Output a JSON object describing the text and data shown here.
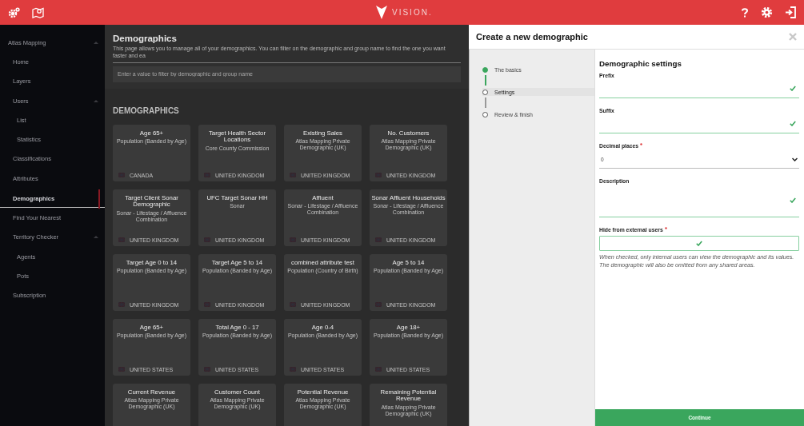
{
  "header": {
    "brand": "VISION."
  },
  "sidebar": {
    "items": [
      {
        "label": "Atlas Mapping",
        "expanded": true,
        "selected": false,
        "children": [
          {
            "label": "Home",
            "selected": false
          },
          {
            "label": "Layers",
            "selected": false
          },
          {
            "label": "Users",
            "expanded": true,
            "selected": false,
            "children": [
              {
                "label": "List",
                "selected": false
              },
              {
                "label": "Statistics",
                "selected": false
              }
            ]
          },
          {
            "label": "Classifications",
            "selected": false
          },
          {
            "label": "Attributes",
            "selected": false
          },
          {
            "label": "Demographics",
            "selected": true
          },
          {
            "label": "Find Your Nearest",
            "selected": false
          },
          {
            "label": "Territory Checker",
            "expanded": true,
            "selected": false,
            "children": [
              {
                "label": "Agents",
                "selected": false
              },
              {
                "label": "Pots",
                "selected": false
              }
            ]
          },
          {
            "label": "Subscription",
            "selected": false
          }
        ]
      }
    ]
  },
  "page": {
    "title": "Demographics",
    "description": "This page allows you to manage all of your demographics. You can filter on the demographic and group name to find the one you want faster and ea",
    "filter_placeholder": "Enter a value to filter by demographic and group name",
    "section": "DEMOGRAPHICS"
  },
  "cards": [
    {
      "title": "Age 65+",
      "subtitle": "Population (Banded by Age)",
      "country": "CANADA"
    },
    {
      "title": "Target Health Sector Locations",
      "subtitle": "Core County Commission",
      "country": "UNITED KINGDOM"
    },
    {
      "title": "Existing Sales",
      "subtitle": "Atlas Mapping Private Demographic (UK)",
      "country": "UNITED KINGDOM"
    },
    {
      "title": "No. Customers",
      "subtitle": "Atlas Mapping Private Demographic (UK)",
      "country": "UNITED KINGDOM"
    },
    {
      "title": "Target Client Sonar Demographic",
      "subtitle": "Sonar - Lifestage / Affluence Combination",
      "country": "UNITED KINGDOM"
    },
    {
      "title": "UFC Target Sonar HH",
      "subtitle": "Sonar",
      "country": "UNITED KINGDOM"
    },
    {
      "title": "Affluent",
      "subtitle": "Sonar - Lifestage / Affluence Combination",
      "country": "UNITED KINGDOM"
    },
    {
      "title": "Sonar Affluent Households",
      "subtitle": "Sonar - Lifestage / Affluence Combination",
      "country": "UNITED KINGDOM"
    },
    {
      "title": "Target Age 0 to 14",
      "subtitle": "Population (Banded by Age)",
      "country": "UNITED KINGDOM"
    },
    {
      "title": "Target Age 5 to 14",
      "subtitle": "Population (Banded by Age)",
      "country": "UNITED KINGDOM"
    },
    {
      "title": "combined attribute test",
      "subtitle": "Population (Country of Birth)",
      "country": "UNITED KINGDOM"
    },
    {
      "title": "Age 5 to 14",
      "subtitle": "Population (Banded by Age)",
      "country": "UNITED KINGDOM"
    },
    {
      "title": "Age 65+",
      "subtitle": "Population (Banded by Age)",
      "country": "UNITED STATES"
    },
    {
      "title": "Total Age 0 - 17",
      "subtitle": "Population (Banded by Age)",
      "country": "UNITED STATES"
    },
    {
      "title": "Age 0-4",
      "subtitle": "Population (Banded by Age)",
      "country": "UNITED STATES"
    },
    {
      "title": "Age 18+",
      "subtitle": "Population (Banded by Age)",
      "country": "UNITED STATES"
    },
    {
      "title": "Current Revenue",
      "subtitle": "Atlas Mapping Private Demographic (UK)"
    },
    {
      "title": "Customer Count",
      "subtitle": "Atlas Mapping Private Demographic (UK)"
    },
    {
      "title": "Potential Revenue",
      "subtitle": "Atlas Mapping Private Demographic (UK)"
    },
    {
      "title": "Remaining Potential Revenue",
      "subtitle": "Atlas Mapping Private Demographic (UK)"
    }
  ],
  "dialog": {
    "title": "Create a new demographic",
    "steps": [
      {
        "label": "The basics",
        "done": true,
        "selected": false
      },
      {
        "label": "Settings",
        "done": false,
        "selected": true
      },
      {
        "label": "Review & finish",
        "done": false,
        "selected": false
      }
    ],
    "form_title": "Demographic settings",
    "fields": [
      {
        "kind": "text",
        "label": "Prefix",
        "valid": true
      },
      {
        "kind": "text",
        "label": "Suffix",
        "valid": true
      },
      {
        "kind": "select",
        "label": "Decimal places",
        "required": true,
        "value": "0"
      },
      {
        "kind": "textarea",
        "label": "Description",
        "valid": true
      },
      {
        "kind": "checkbox",
        "label": "Hide from external users",
        "required": true,
        "checked": true,
        "help": "When checked, only internal users can view the demographic and its values. The demographic will also be omitted from any shared areas."
      }
    ],
    "button": "Continue"
  }
}
